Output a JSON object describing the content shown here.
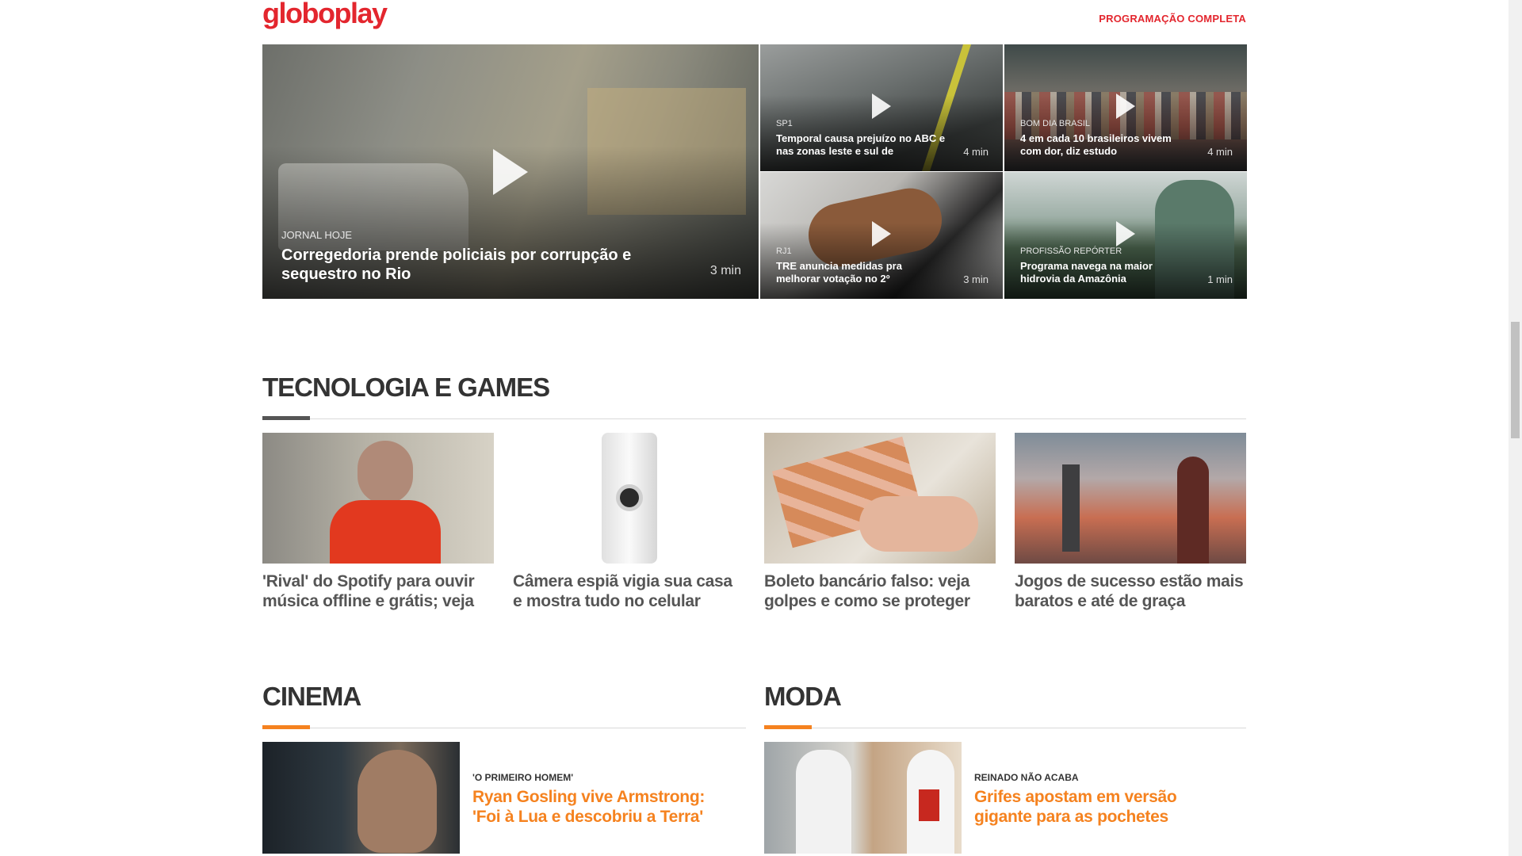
{
  "header": {
    "logo": "globoplay",
    "full_schedule": "PROGRAMAÇÃO COMPLETA",
    "brand_color": "#e3262e"
  },
  "videos": [
    {
      "program": "JORNAL HOJE",
      "title": "Corregedoria prende policiais por corrupção e sequestro no Rio",
      "duration": "3 min"
    },
    {
      "program": "SP1",
      "title": "Temporal causa prejuízo no ABC e nas zonas leste e sul de",
      "duration": "4 min"
    },
    {
      "program": "BOM DIA BRASIL",
      "title": "4 em cada 10 brasileiros vivem com dor, diz estudo",
      "duration": "4 min"
    },
    {
      "program": "RJ1",
      "title": "TRE anuncia medidas pra melhorar votação no 2º",
      "duration": "3 min"
    },
    {
      "program": "PROFISSÃO REPÓRTER",
      "title": "Programa navega na maior hidrovia da Amazônia",
      "duration": "1 min"
    }
  ],
  "tech": {
    "title": "TECNOLOGIA E GAMES",
    "accent": "#555555",
    "items": [
      {
        "title": "'Rival' do Spotify para ouvir música offline e grátis; veja"
      },
      {
        "title": "Câmera espiã vigia sua casa e mostra tudo no celular"
      },
      {
        "title": "Boleto bancário falso: veja golpes e como se proteger"
      },
      {
        "title": "Jogos de sucesso estão mais baratos e até de graça"
      }
    ]
  },
  "cinema": {
    "title": "CINEMA",
    "accent": "#f5821f",
    "kicker": "'O PRIMEIRO HOMEM'",
    "headline": "Ryan Gosling vive Armstrong: 'Foi à Lua e descobriu a Terra'"
  },
  "moda": {
    "title": "MODA",
    "accent": "#f5821f",
    "kicker": "REINADO NÃO ACABA",
    "headline": "Grifes apostam em versão gigante para as pochetes"
  }
}
